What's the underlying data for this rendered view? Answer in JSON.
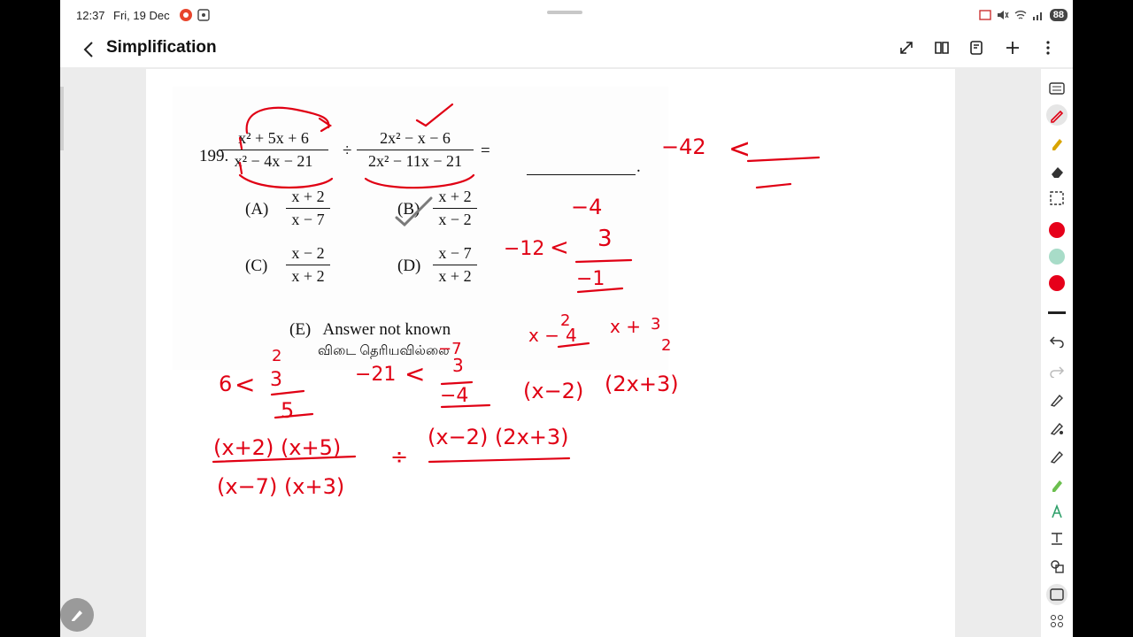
{
  "status": {
    "time": "12:37",
    "date": "Fri, 19 Dec",
    "battery": "88"
  },
  "app": {
    "title": "Simplification"
  },
  "question": {
    "number": "199.",
    "frac1_num": "x² + 5x + 6",
    "frac1_den": "x² − 4x − 21",
    "divide": "÷",
    "frac2_num": "2x² − x − 6",
    "frac2_den": "2x² − 11x − 21",
    "equals": "=",
    "period": ".",
    "options": [
      {
        "label": "(A)",
        "num": "x + 2",
        "den": "x − 7"
      },
      {
        "label": "(B)",
        "num": "x + 2",
        "den": "x − 2"
      },
      {
        "label": "(C)",
        "num": "x − 2",
        "den": "x + 2"
      },
      {
        "label": "(D)",
        "num": "x − 7",
        "den": "x + 2"
      }
    ],
    "optionE_label": "(E)",
    "optionE_text": "Answer not known",
    "optionE_tamil": "விடை தெரியவில்லை"
  },
  "handwriting": {
    "color": "#e00014",
    "n42": "−42",
    "lt": "<",
    "n4": "−4",
    "n12": "−12",
    "n3": "3",
    "n1": "−1",
    "six": "6",
    "two_a": "2",
    "three_a": "3",
    "five": "5",
    "n21": "−21",
    "n7": "−7",
    "three_b": "3",
    "n4b": "−4",
    "xfrac_top": "2",
    "x_minus": "x −",
    "four_struck": "4",
    "x_plus": "x +",
    "three_c": "3",
    "two_c": "2",
    "fac1": "(x−2)",
    "fac2": "(2x+3)",
    "big_num": "(x+2) (x+5)",
    "big_den": "(x−7)   (x+3)",
    "div": "÷",
    "rhs_num": "(x−2)   (2x+3)"
  },
  "colors": {
    "red": "#e6001a",
    "mint": "#a8dcc8",
    "accent": "#e00014"
  }
}
